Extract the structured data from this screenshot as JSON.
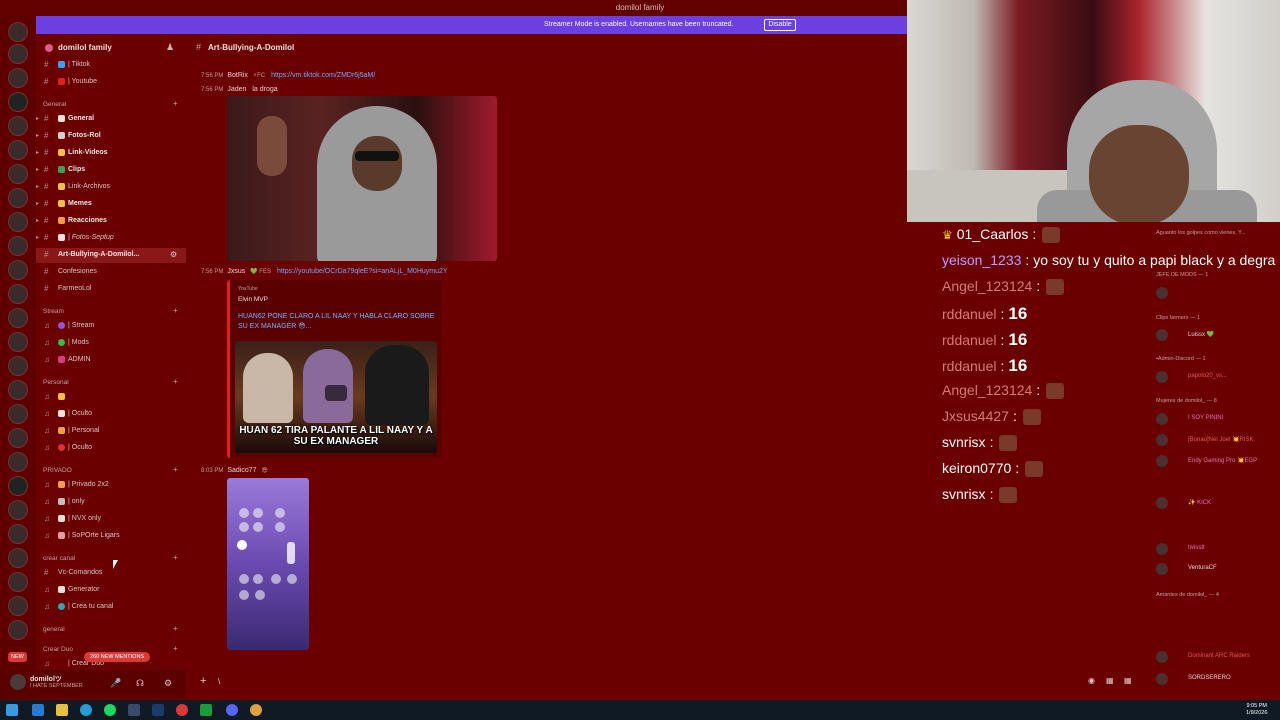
{
  "window": {
    "title": "domilol family"
  },
  "banner": {
    "text": "Streamer Mode is enabled. Usernames have been truncated.",
    "button": "Disable"
  },
  "guild": {
    "name": "domilol family"
  },
  "sidebar": {
    "top_channels": [
      {
        "label": "| Tiktok",
        "color": "#3aa0ff"
      },
      {
        "label": "| Youtube",
        "color": "#e02020"
      }
    ],
    "categories": {
      "general": "General",
      "stream": "Stream",
      "personal": "Personal",
      "privado": "PRIVADO",
      "crear_canal": "crear canal",
      "general2": "general",
      "crear_duo": "Crear Duo"
    },
    "general_channels": [
      {
        "label": "General",
        "color": "#f0e0e0",
        "bold": true
      },
      {
        "label": "Fotos-Rol",
        "color": "#d0d0d0",
        "bold": true
      },
      {
        "label": "Link-Videos",
        "color": "#f0c040",
        "bold": true
      },
      {
        "label": "Clips",
        "color": "#3aa060",
        "bold": true
      },
      {
        "label": "Link-Archivos",
        "color": "#f0c040",
        "bold": false
      },
      {
        "label": "Memes",
        "color": "#f0c040",
        "bold": true
      },
      {
        "label": "Reacciones",
        "color": "#f0a040",
        "bold": true
      },
      {
        "label": "| Fotos-Septup",
        "color": "#f0e0e0",
        "bold": false
      }
    ],
    "active_channel": "Art-Bullying-A-Domilol...",
    "plain_channels": [
      "Confesiones",
      "FarmeoLol"
    ],
    "stream_channels": [
      {
        "label": "| Stream",
        "color": "#8a5ad8"
      },
      {
        "label": "| Mods",
        "color": "#30c040"
      },
      {
        "label": "ADMIN",
        "color": "#d83a8a"
      }
    ],
    "personal_channels": [
      "| Oculto",
      "| Personal",
      "| Oculto"
    ],
    "privado_channels": [
      "| Privado 2x2",
      "| only",
      "| NVX only",
      "| SoPOrte Ligars"
    ],
    "crear_channels": [
      "Vc-Comandos",
      "Generator",
      "| Crea tu canal"
    ],
    "crear_duo_channel": "| Crear Duo"
  },
  "user": {
    "name": "domilolツ",
    "status": "I HATE SEPTEMBER"
  },
  "mentions": "260 NEW MENTIONS",
  "new_badge": "NEW",
  "chat": {
    "channel": "Art-Bullying-A-Domilol",
    "messages": [
      {
        "time": "7:56 PM",
        "author": "BotRix",
        "tag": "⚡FC",
        "link": "https://vm.tiktok.com/ZMDr6j5aM/",
        "text": ""
      },
      {
        "time": "7:56 PM",
        "author": "Jaden",
        "tag": "",
        "link": "",
        "text": "la droga"
      },
      {
        "time": "7:56 PM",
        "author": "Jxsus",
        "tag": "💚 FES",
        "link": "https://youtube/OCrDa79qleE?si=anALjL_M0Huymu2Y",
        "text": ""
      },
      {
        "time": "8:03 PM",
        "author": "Sadico77",
        "tag": "😎",
        "link": "",
        "text": ""
      }
    ],
    "embed": {
      "provider": "YouTube",
      "author": "Elvin MVP",
      "title": "HUAN62 PONE CLARO A LIL NAAY Y HABLA CLARO SOBRE SU EX MANAGER 😳...",
      "thumb_caption": "HUAN 62 TIRA PALANTE A LIL NAAY Y A SU EX MANAGER"
    },
    "composer_value": "\\"
  },
  "stream_chat": [
    {
      "user": "01_Caarlos",
      "color": "#ffffff",
      "text": "",
      "crown": true,
      "emote": true
    },
    {
      "user": "yeison_1233",
      "color": "#b8a0ff",
      "text": "yo soy tu y quito a papi black y a degra"
    },
    {
      "user": "Angel_123124",
      "color": "#d87a7a",
      "text": "",
      "emote": true
    },
    {
      "user": "rddanuel",
      "color": "#d87a7a",
      "text": "16",
      "big": true
    },
    {
      "user": "rddanuel",
      "color": "#d87a7a",
      "text": "16",
      "big": true
    },
    {
      "user": "rddanuel",
      "color": "#d87a7a",
      "text": "16",
      "big": true
    },
    {
      "user": "Angel_123124",
      "color": "#d87a7a",
      "text": "",
      "emote": true
    },
    {
      "user": "Jxsus4427",
      "color": "#d87a7a",
      "text": "",
      "emote": true
    },
    {
      "user": "svnrisx",
      "color": "#ffffff",
      "text": "",
      "emote": true
    },
    {
      "user": "keiron0770",
      "color": "#ffffff",
      "text": "",
      "emote": true
    },
    {
      "user": "svnrisx",
      "color": "#ffffff",
      "text": "",
      "emote": true
    }
  ],
  "members": {
    "top_note": "Aguanto los golpes como vienes, Y...",
    "groups": [
      {
        "label": "JEFE DE MODS — 1"
      },
      {
        "label": "Clips farmers — 1"
      },
      {
        "label": "•Admin-Discord — 1"
      },
      {
        "label": "Mujeres de domilol_ — 8"
      },
      {
        "label": "Amantes de domilol_ — 4"
      }
    ],
    "items": [
      {
        "name": "Luissx 💚",
        "color": "#e8d0d0"
      },
      {
        "name": "papolo20_vs...",
        "color": "#e05a5a"
      },
      {
        "name": "I SOY PININI",
        "color": "#e070c0"
      },
      {
        "name": "[Bonao]Nel Joel 💥RISK",
        "color": "#e05a5a"
      },
      {
        "name": "Endy Gaming Pro 💥EGP",
        "color": "#e070c0"
      },
      {
        "name": "✨ KICK",
        "color": "#e070c0"
      },
      {
        "name": "twisstt",
        "color": "#e070c0"
      },
      {
        "name": "VenturaCF",
        "color": "#e8d0d0"
      },
      {
        "name": "Dominant ARC Raiders",
        "color": "#e05a5a"
      },
      {
        "name": "SORDSERERO",
        "color": "#e8d0d0"
      }
    ]
  },
  "taskbar": {
    "time": "9:05 PM",
    "date": "1/9/2026"
  }
}
